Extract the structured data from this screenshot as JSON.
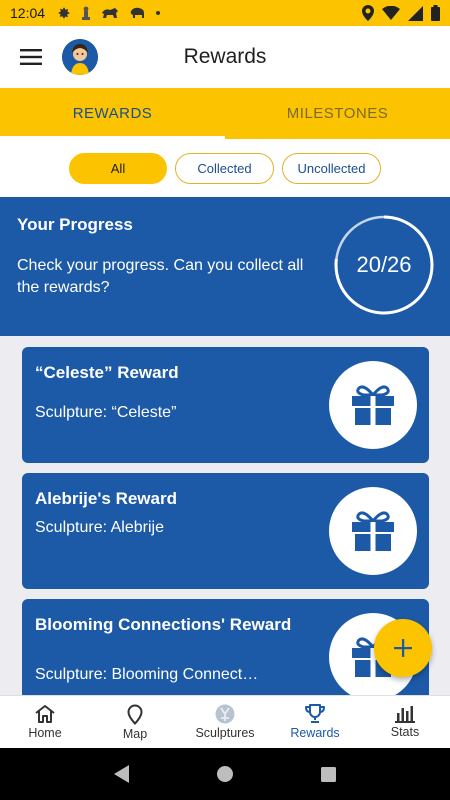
{
  "status_bar": {
    "time": "12:04"
  },
  "app_bar": {
    "title": "Rewards"
  },
  "tabs": [
    {
      "label": "REWARDS",
      "active": true
    },
    {
      "label": "MILESTONES",
      "active": false
    }
  ],
  "filters": [
    {
      "label": "All",
      "selected": true
    },
    {
      "label": "Collected",
      "selected": false
    },
    {
      "label": "Uncollected",
      "selected": false
    }
  ],
  "progress": {
    "title": "Your Progress",
    "description": "Check your progress. Can you collect all the rewards?",
    "label": "20/26",
    "collected": 20,
    "total": 26
  },
  "rewards": [
    {
      "title": "“Celeste” Reward",
      "subtitle": "Sculpture: “Celeste”"
    },
    {
      "title": "Alebrije's Reward",
      "subtitle": "Sculpture: Alebrije"
    },
    {
      "title": "Blooming Connections' Reward",
      "subtitle": "Sculpture: Blooming Connect…"
    }
  ],
  "bottom_nav": [
    {
      "label": "Home",
      "icon": "home-icon",
      "active": false
    },
    {
      "label": "Map",
      "icon": "map-pin-icon",
      "active": false
    },
    {
      "label": "Sculptures",
      "icon": "sculpture-icon",
      "active": false
    },
    {
      "label": "Rewards",
      "icon": "trophy-icon",
      "active": true
    },
    {
      "label": "Stats",
      "icon": "bar-chart-icon",
      "active": false
    }
  ],
  "colors": {
    "brand_blue": "#1c59a6",
    "brand_yellow": "#fbc300"
  }
}
